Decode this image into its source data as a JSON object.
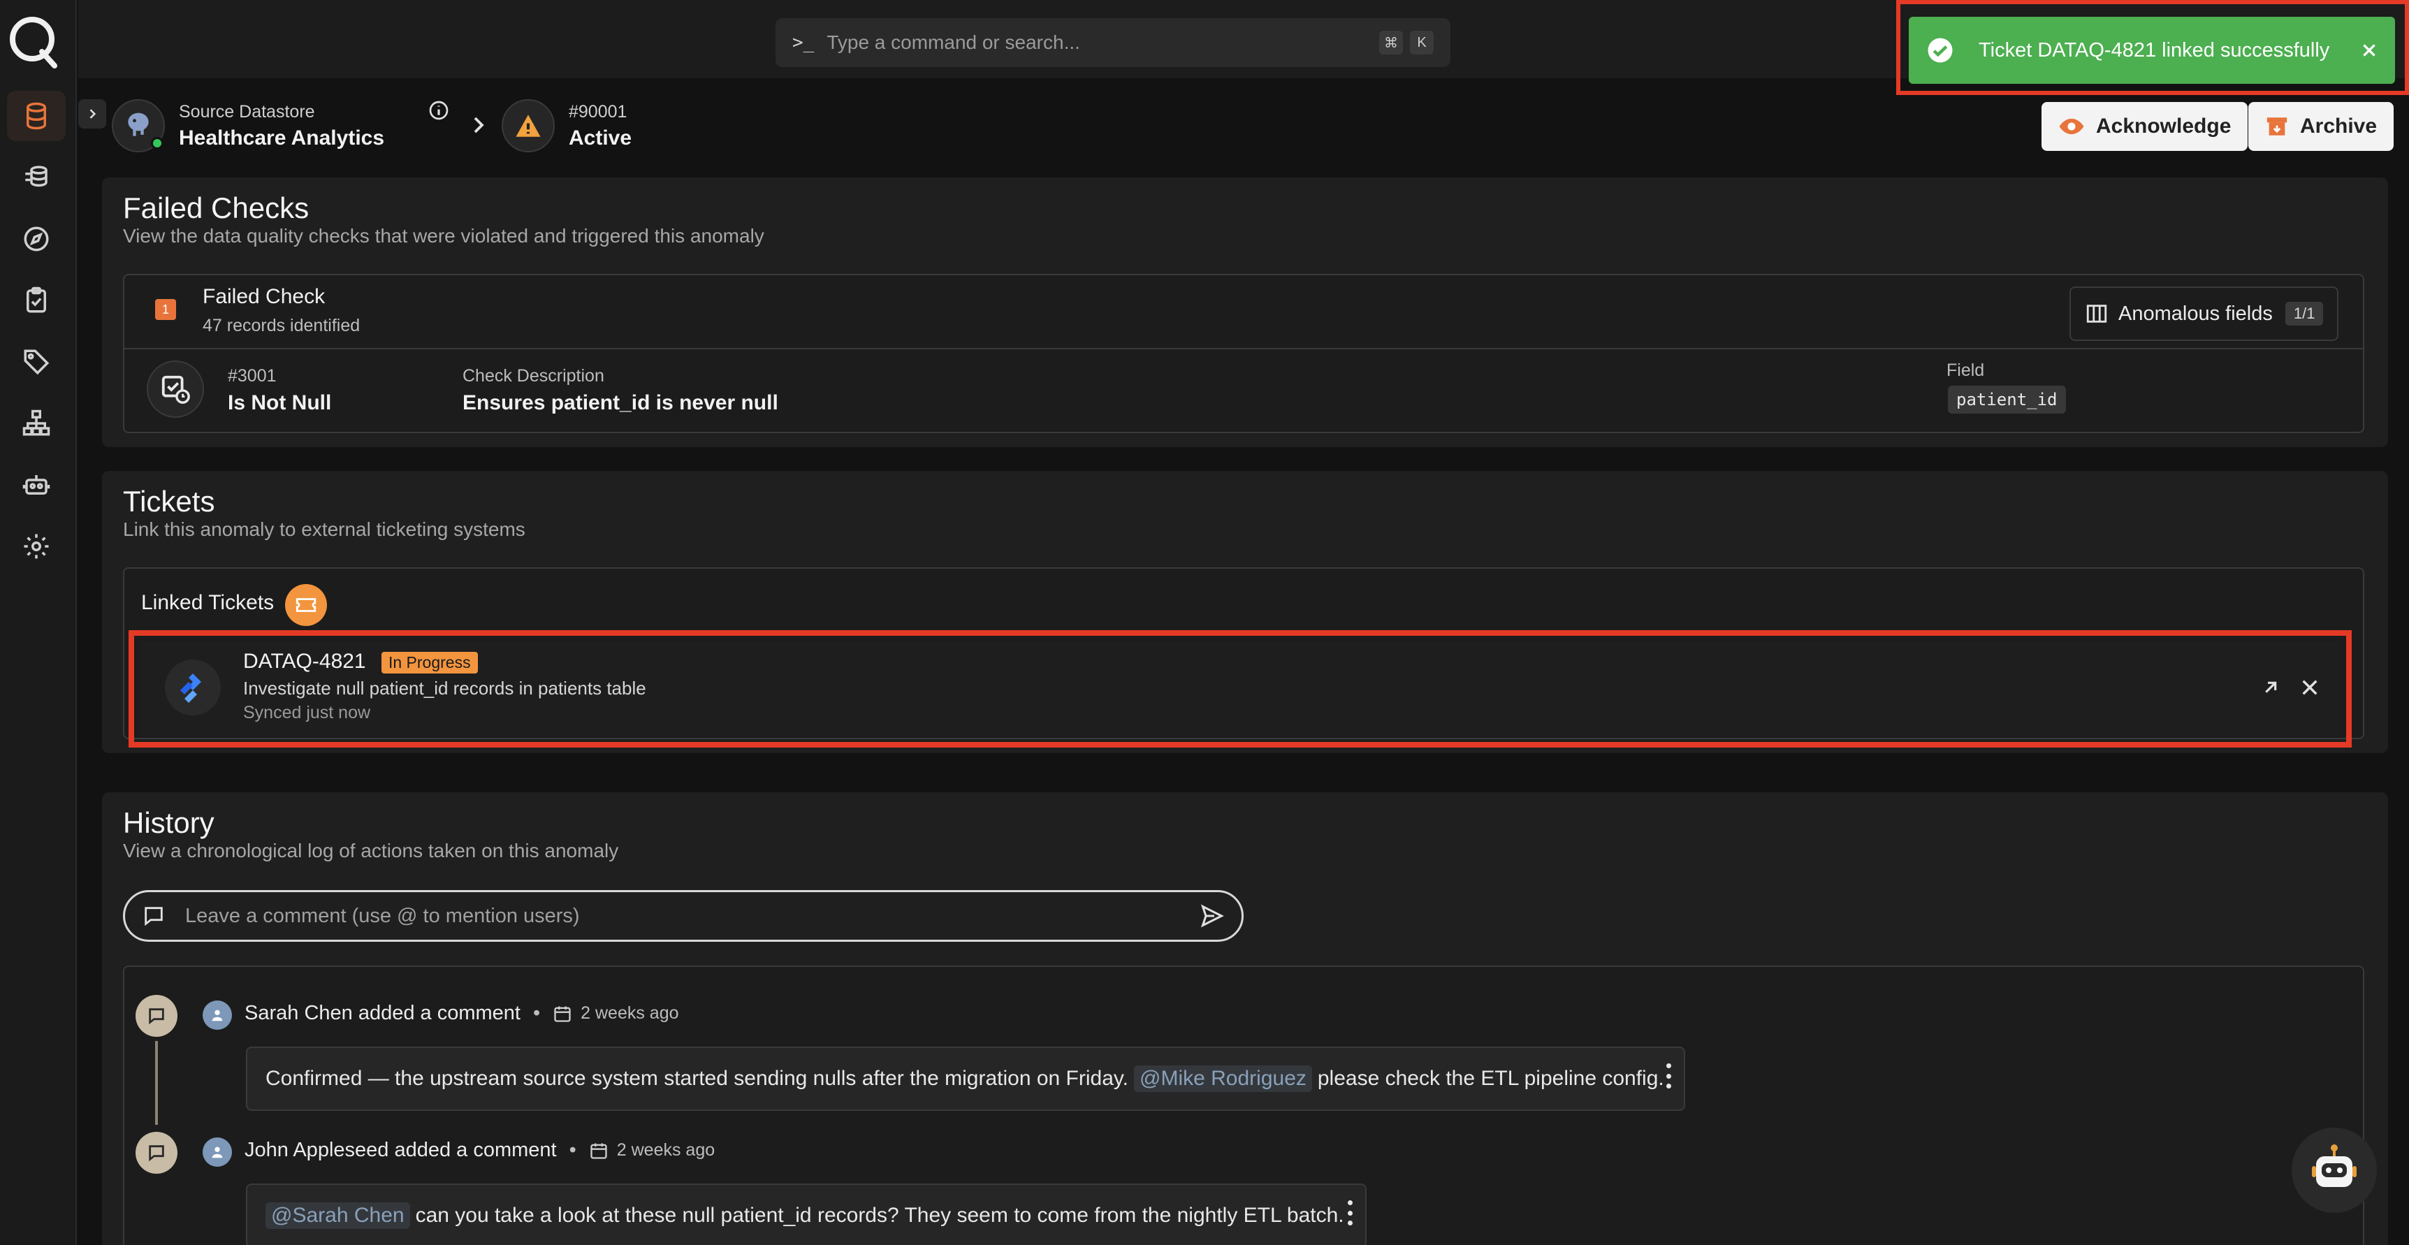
{
  "search": {
    "placeholder": "Type a command or search...",
    "kbd1": "⌘",
    "kbd2": "K"
  },
  "breadcrumb": {
    "source_label": "Source Datastore",
    "source_name": "Healthcare Analytics",
    "anomaly_id": "#90001",
    "anomaly_status": "Active"
  },
  "actions": {
    "acknowledge": "Acknowledge",
    "archive": "Archive"
  },
  "toast": {
    "message": "Ticket DATAQ-4821 linked successfully"
  },
  "failed_checks": {
    "title": "Failed Checks",
    "subtitle": "View the data quality checks that were violated and triggered this anomaly",
    "count_badge": "1",
    "heading": "Failed Check",
    "records": "47 records identified",
    "anomalous_fields_label": "Anomalous fields",
    "anomalous_fields_count": "1/1",
    "check": {
      "id": "#3001",
      "name": "Is Not Null",
      "description_label": "Check Description",
      "description": "Ensures patient_id is never null",
      "field_label": "Field",
      "field": "patient_id"
    }
  },
  "tickets": {
    "title": "Tickets",
    "subtitle": "Link this anomaly to external ticketing systems",
    "linked_label": "Linked Tickets",
    "ticket": {
      "key": "DATAQ-4821",
      "status": "In Progress",
      "summary": "Investigate null patient_id records in patients table",
      "sync": "Synced just now"
    }
  },
  "history": {
    "title": "History",
    "subtitle": "View a chronological log of actions taken on this anomaly",
    "comment_placeholder": "Leave a comment (use @ to mention users)",
    "entries": [
      {
        "header": "Sarah Chen added a comment",
        "when": "2 weeks ago",
        "text_before": "Confirmed — the upstream source system started sending nulls after the migration on Friday.",
        "mention": "@Mike Rodriguez",
        "text_after": "please check the ETL pipeline config."
      },
      {
        "header": "John Appleseed added a comment",
        "when": "2 weeks ago",
        "mention": "@Sarah Chen",
        "text_after": "can you take a look at these null patient_id records? They seem to come from the nightly ETL batch."
      }
    ]
  },
  "colors": {
    "accent": "#e8743b",
    "toast": "#4caf50",
    "highlight": "#e53a26",
    "status_pill": "#f3953e"
  }
}
